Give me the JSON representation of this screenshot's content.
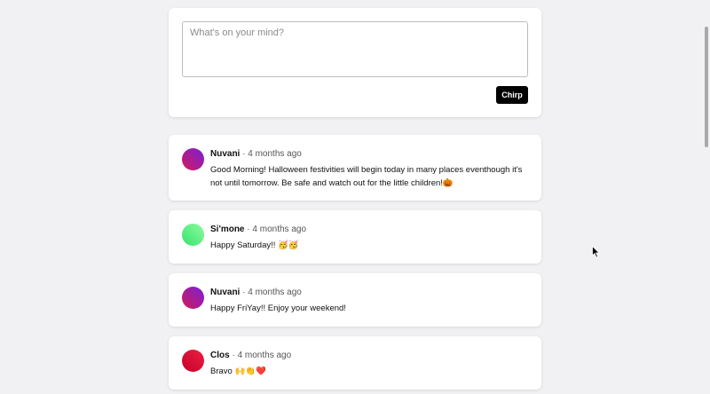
{
  "composer": {
    "placeholder": "What's on your mind?",
    "value": "",
    "submit_label": "Chirp"
  },
  "posts": [
    {
      "author": "Nuvani",
      "separator": "·",
      "time": "4 months ago",
      "text": "Good Morning! Halloween festivities will begin today in many places eventhough it's not until tomorrow. Be safe and watch out for the little children!",
      "emoji": "🎃",
      "avatar_gradient": [
        "#d11b5b",
        "#7b1fd6"
      ]
    },
    {
      "author": "Si'mone",
      "separator": "·",
      "time": "4 months ago",
      "text": "Happy Saturday!! ",
      "emoji": "🥳🥳",
      "avatar_gradient": [
        "#35e36f",
        "#8dfb9e"
      ]
    },
    {
      "author": "Nuvani",
      "separator": "·",
      "time": "4 months ago",
      "text": "Happy FriYay!! Enjoy your weekend!",
      "emoji": "",
      "avatar_gradient": [
        "#d11b5b",
        "#7b1fd6"
      ]
    },
    {
      "author": "Clos",
      "separator": "·",
      "time": "4 months ago",
      "text": "Bravo ",
      "emoji": "🙌👏❤️",
      "avatar_gradient": [
        "#c7002d",
        "#ec1f3f"
      ]
    }
  ]
}
